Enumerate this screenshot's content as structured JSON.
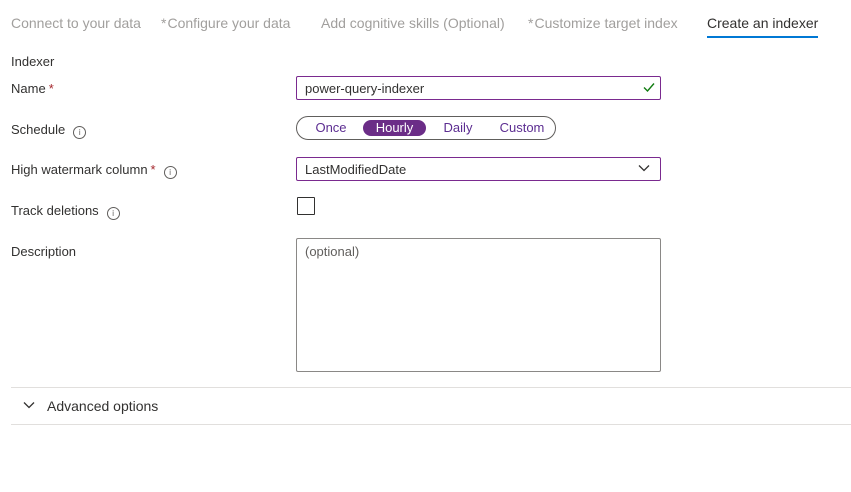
{
  "tabs": [
    {
      "label": "Connect to your data",
      "required": false,
      "active": false
    },
    {
      "label": "Configure your data",
      "required": true,
      "active": false
    },
    {
      "label": "Add cognitive skills (Optional)",
      "required": false,
      "active": false
    },
    {
      "label": "Customize target index",
      "required": true,
      "active": false
    },
    {
      "label": "Create an indexer",
      "required": false,
      "active": true
    }
  ],
  "required_marker": "*",
  "section_title": "Indexer",
  "form": {
    "name": {
      "label": "Name",
      "value": "power-query-indexer",
      "valid": true
    },
    "schedule": {
      "label": "Schedule",
      "options": [
        "Once",
        "Hourly",
        "Daily",
        "Custom"
      ],
      "selected": "Hourly"
    },
    "high_watermark": {
      "label": "High watermark column",
      "value": "LastModifiedDate"
    },
    "track_deletions": {
      "label": "Track deletions",
      "checked": false
    },
    "description": {
      "label": "Description",
      "placeholder": "(optional)"
    }
  },
  "advanced": {
    "label": "Advanced options",
    "expanded": false
  },
  "colors": {
    "accent": "#0078d4",
    "selected_pill": "#6b2d87",
    "required": "#a4262c",
    "valid": "#107c10"
  },
  "icons": {
    "info": "info-icon",
    "check": "checkmark-icon",
    "dropdown": "chevron-down-icon"
  }
}
